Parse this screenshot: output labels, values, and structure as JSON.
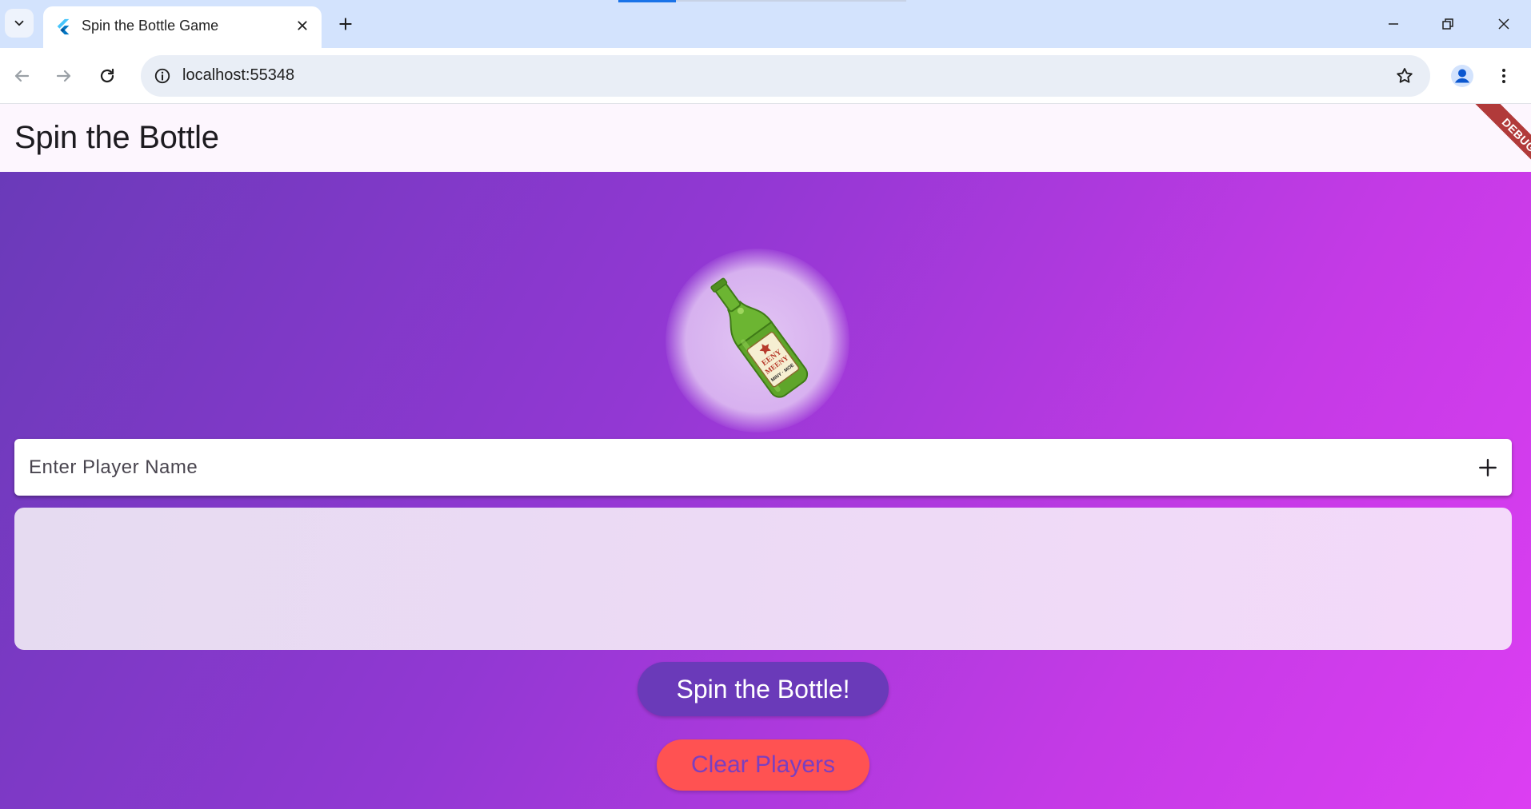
{
  "browser": {
    "tab": {
      "title": "Spin the Bottle Game",
      "favicon": "flutter-icon"
    },
    "address_bar": {
      "url": "localhost:55348"
    },
    "icons": {
      "tab_search": "chevron-down-icon",
      "tab_close": "close-icon",
      "new_tab": "plus-icon",
      "back": "arrow-left-icon",
      "forward": "arrow-right-icon",
      "reload": "reload-icon",
      "site_info": "info-icon",
      "bookmark": "star-icon",
      "profile": "person-icon",
      "menu": "vertical-dots-icon",
      "minimize": "minimize-icon",
      "restore": "restore-icon",
      "close_window": "close-icon"
    }
  },
  "app": {
    "title": "Spin the Bottle",
    "debug_banner": "DEBUG",
    "bottle": {
      "label_lines": [
        "EENY",
        "MEENY",
        "MINY · MOE"
      ],
      "color": "#5fa52a"
    },
    "player_input": {
      "placeholder": "Enter Player Name",
      "value": ""
    },
    "add_player_icon": "plus-icon",
    "players": [],
    "spin_button_label": "Spin the Bottle!",
    "clear_button_label": "Clear Players"
  },
  "colors": {
    "tabstrip_bg": "#d3e3fd",
    "appbar_bg": "#fdf6fe",
    "gradient_start": "#6a3ab9",
    "gradient_end": "#dc3ef2",
    "spin_button_bg": "#6a3ab9",
    "clear_button_bg": "#ff5252",
    "clear_button_text": "#7b3fbf",
    "debug_banner_bg": "#b13a3a"
  }
}
